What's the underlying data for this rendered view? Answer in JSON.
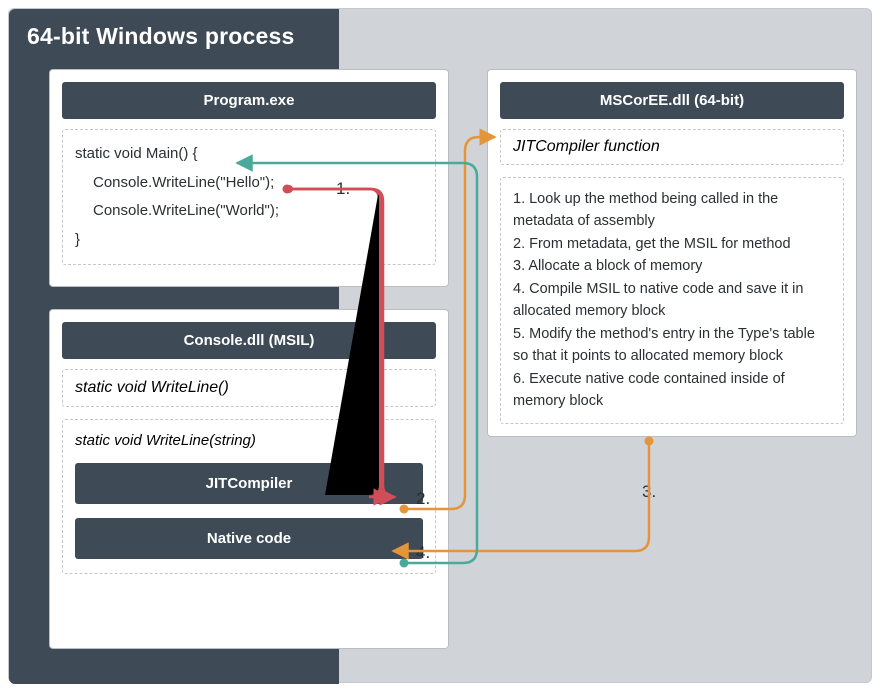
{
  "colors": {
    "bg_outer": "#d0d4d9",
    "bg_dark": "#3f4a57",
    "card_bg": "#ffffff",
    "arrow_red": "#d14d57",
    "arrow_orange": "#e4953a",
    "arrow_teal": "#4aa99a"
  },
  "process_title": "64-bit Windows process",
  "program": {
    "title": "Program.exe",
    "code": {
      "l1": "static void Main() {",
      "l2": "Console.WriteLine(\"Hello\");",
      "l3": "Console.WriteLine(\"World\");",
      "l4": "}"
    }
  },
  "console": {
    "title": "Console.dll (MSIL)",
    "sig_empty": "static void WriteLine()",
    "sig_string": "static void WriteLine(string)",
    "jit_label": "JITCompiler",
    "native_label": "Native code"
  },
  "mscoree": {
    "title": "MSCorEE.dll (64-bit)",
    "func": "JITCompiler function",
    "steps": {
      "s1": "1. Look up the method being called in the metadata of assembly",
      "s2": "2. From metadata, get the MSIL for method",
      "s3": "3. Allocate a block of memory",
      "s4": "4. Compile MSIL to native code and save it in allocated memory block",
      "s5": "5. Modify the method's entry in the Type's table so that it points to allocated memory block",
      "s6": "6. Execute native code contained inside of memory block"
    }
  },
  "labels": {
    "n1": "1.",
    "n2": "2.",
    "n3": "3.",
    "n4": "4."
  }
}
